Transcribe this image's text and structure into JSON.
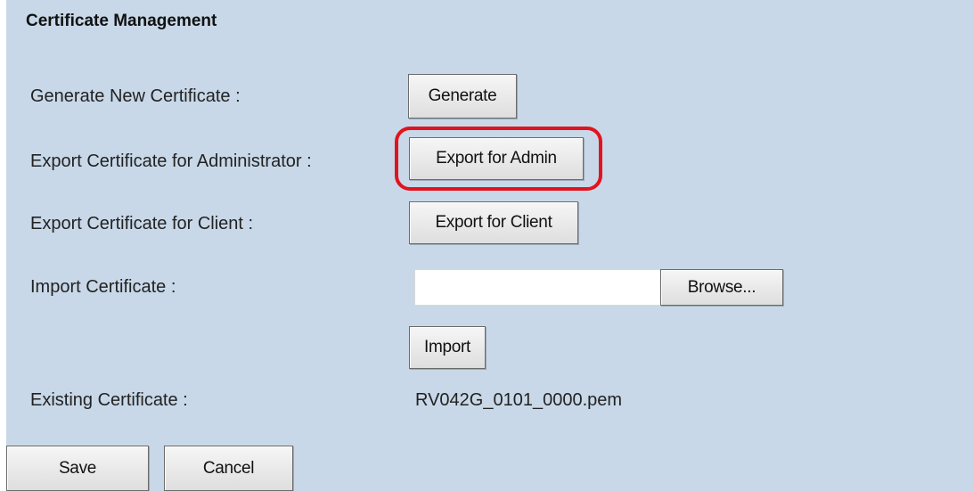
{
  "section": {
    "title": "Certificate Management"
  },
  "rows": {
    "generate": {
      "label": "Generate New Certificate :",
      "button": "Generate"
    },
    "export_admin": {
      "label": "Export Certificate for Administrator :",
      "button": "Export for Admin"
    },
    "export_client": {
      "label": "Export Certificate for Client :",
      "button": "Export for Client"
    },
    "import": {
      "label": "Import Certificate :",
      "file_value": "",
      "browse_button": "Browse...",
      "import_button": "Import"
    },
    "existing": {
      "label": "Existing Certificate :",
      "value": "RV042G_0101_0000.pem"
    }
  },
  "footer": {
    "save_label": "Save",
    "cancel_label": "Cancel"
  },
  "colors": {
    "panel_background": "#c8d8e8",
    "highlight_ring": "#e0141e"
  }
}
